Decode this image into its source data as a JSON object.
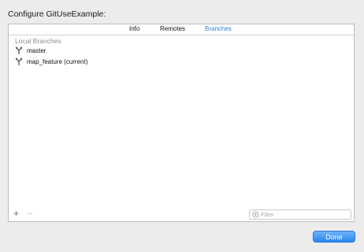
{
  "dialog": {
    "title": "Configure GitUseExample:"
  },
  "tabs": [
    {
      "label": "Info",
      "active": false
    },
    {
      "label": "Remotes",
      "active": false
    },
    {
      "label": "Branches",
      "active": true
    }
  ],
  "section": {
    "header": "Local Branches"
  },
  "branches": [
    {
      "label": "master",
      "icon": "branch-icon"
    },
    {
      "label": "map_feature (current)",
      "icon": "branch-icon"
    }
  ],
  "footer": {
    "add_label": "+",
    "remove_label": "−",
    "filter_placeholder": "Filter",
    "filter_value": ""
  },
  "done_button": {
    "label": "Done"
  },
  "colors": {
    "accent": "#2f7ee6",
    "button": "#2a86ee"
  }
}
